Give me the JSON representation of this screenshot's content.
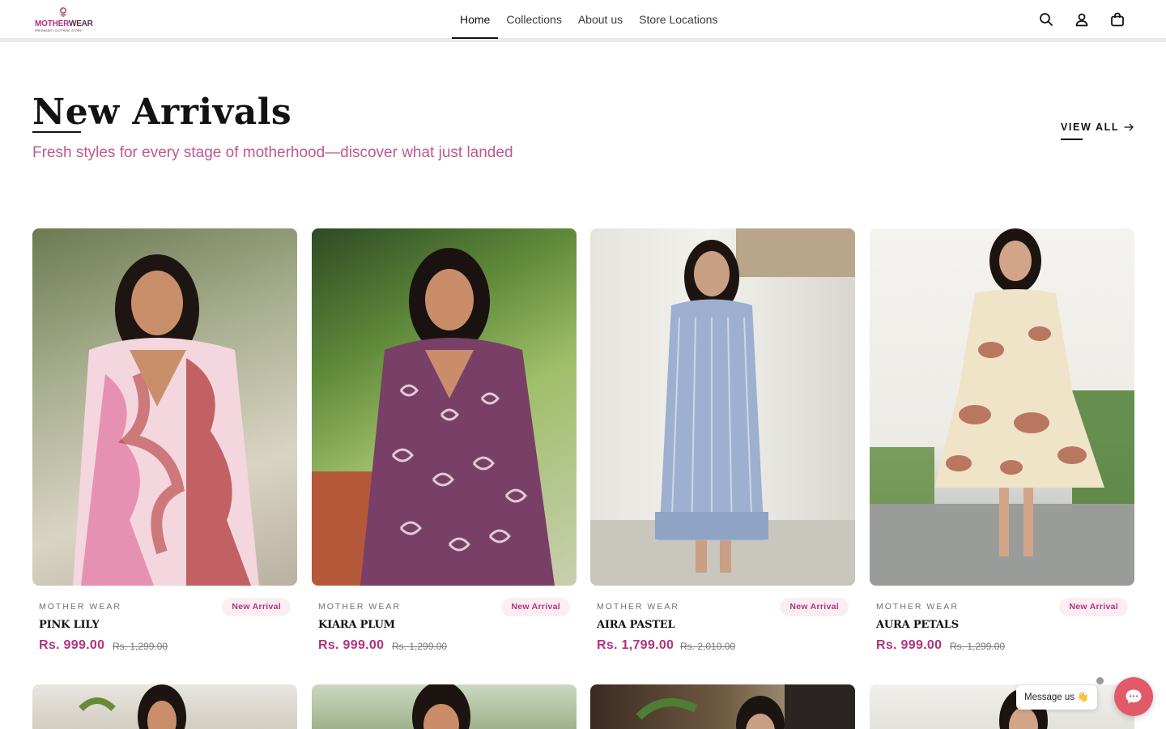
{
  "header": {
    "logo": {
      "brand_part1": "MOTHER",
      "brand_part2": "WEAR",
      "tagline": "PREGNANCY CLOTHING STORE"
    },
    "nav": [
      {
        "label": "Home",
        "active": true
      },
      {
        "label": "Collections",
        "active": false
      },
      {
        "label": "About us",
        "active": false
      },
      {
        "label": "Store Locations",
        "active": false
      }
    ],
    "icons": [
      "search-icon",
      "account-icon",
      "cart-icon"
    ]
  },
  "section": {
    "title": "New Arrivals",
    "subtitle": "Fresh styles for every stage of motherhood—discover what just landed",
    "view_all": "VIEW ALL"
  },
  "products": [
    {
      "vendor": "MOTHER WEAR",
      "badge": "New Arrival",
      "name": "PINK LILY",
      "price": "Rs. 999.00",
      "compare_price": "Rs. 1,299.00"
    },
    {
      "vendor": "MOTHER WEAR",
      "badge": "New Arrival",
      "name": "KIARA PLUM",
      "price": "Rs. 999.00",
      "compare_price": "Rs. 1,299.00"
    },
    {
      "vendor": "MOTHER WEAR",
      "badge": "New Arrival",
      "name": "AIRA PASTEL",
      "price": "Rs. 1,799.00",
      "compare_price": "Rs. 2,010.00"
    },
    {
      "vendor": "MOTHER WEAR",
      "badge": "New Arrival",
      "name": "AURA PETALS",
      "price": "Rs. 999.00",
      "compare_price": "Rs. 1,299.00"
    }
  ],
  "chat": {
    "message": "Message us 👋"
  },
  "colors": {
    "accent": "#b2327e",
    "subtitle": "#c1578f",
    "chat": "#e25a6a"
  }
}
